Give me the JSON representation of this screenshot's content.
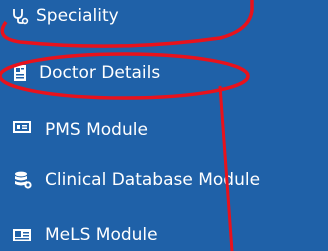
{
  "menu": {
    "items": [
      {
        "label": "Speciality",
        "icon": "stethoscope-icon"
      },
      {
        "label": "Doctor Details",
        "icon": "doctor-card-icon"
      },
      {
        "label": "PMS Module",
        "icon": "pms-monitor-icon"
      },
      {
        "label": "Clinical Database Module",
        "icon": "database-icon"
      },
      {
        "label": "MeLS Module",
        "icon": "mels-card-icon"
      }
    ]
  },
  "colors": {
    "background": "#1f61a8",
    "text": "#ffffff",
    "annotation": "#e8121c"
  }
}
